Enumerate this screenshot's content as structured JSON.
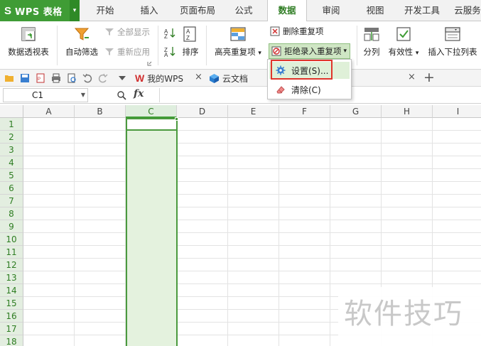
{
  "app": {
    "logo": "S",
    "name": "WPS 表格"
  },
  "menu_tabs": [
    "开始",
    "插入",
    "页面布局",
    "公式",
    "数据",
    "审阅",
    "视图",
    "开发工具",
    "云服务"
  ],
  "active_tab": "数据",
  "ribbon": {
    "pivot_table": "数据透视表",
    "auto_filter": "自动筛选",
    "show_all": "全部显示",
    "reapply": "重新应用",
    "sort": "排序",
    "highlight_dup": "高亮重复项",
    "highlight_dup_caret": "▾",
    "remove_dup": "删除重复项",
    "reject_dup": "拒绝录入重复项",
    "reject_dup_caret": "▾",
    "split_column": "分列",
    "validity": "有效性",
    "validity_caret": "▾",
    "insert_dropdown": "插入下拉列表"
  },
  "doc_tabs": {
    "my_wps": "我的WPS",
    "cloud_docs": "云文档",
    "close": "×",
    "add": "+"
  },
  "formula_bar": {
    "name_box": "C1",
    "fx": "fx"
  },
  "grid": {
    "columns": [
      "A",
      "B",
      "C",
      "D",
      "E",
      "F",
      "G",
      "H",
      "I"
    ],
    "selected_column": "C",
    "rows": [
      "1",
      "2",
      "3",
      "4",
      "5",
      "6",
      "7",
      "8",
      "9",
      "10",
      "11",
      "12",
      "13",
      "14",
      "15",
      "16",
      "17",
      "18"
    ]
  },
  "dropdown_menu": {
    "settings": "设置(S)...",
    "clear": "清除(C)"
  },
  "watermark": "软件技巧",
  "colors": {
    "brand_green": "#3f9c35",
    "selection_fill": "#e4f2de",
    "highlight_red": "#e0352b"
  }
}
